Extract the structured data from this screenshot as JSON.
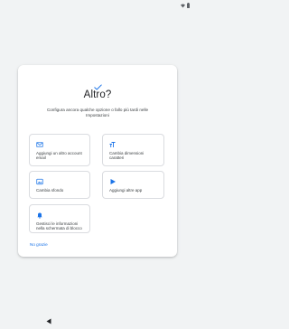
{
  "colors": {
    "accent": "#1a73e8",
    "background": "#f1f3f4",
    "card": "#ffffff"
  },
  "status_bar": {
    "icons": [
      "wifi-icon",
      "battery-icon"
    ]
  },
  "dialog": {
    "check_icon": "check-icon",
    "title": "Altro?",
    "subtitle": "Configura ancora qualche opzione o fallo più tardi nelle Impostazioni"
  },
  "options": [
    {
      "label": "Aggiungi un altro account email",
      "icon": "email-accounts-icon"
    },
    {
      "label": "Cambia dimensioni caratteri",
      "icon": "font-size-icon"
    },
    {
      "label": "Cambia sfondo",
      "icon": "wallpaper-icon"
    },
    {
      "label": "Aggiungi altre app",
      "icon": "play-store-icon"
    },
    {
      "label": "Gestisci le informazioni nella schermata di blocco",
      "icon": "bell-icon"
    }
  ],
  "footer": {
    "link_label": "No grazie"
  },
  "nav_bar": {
    "back_icon": "back-triangle-icon"
  }
}
